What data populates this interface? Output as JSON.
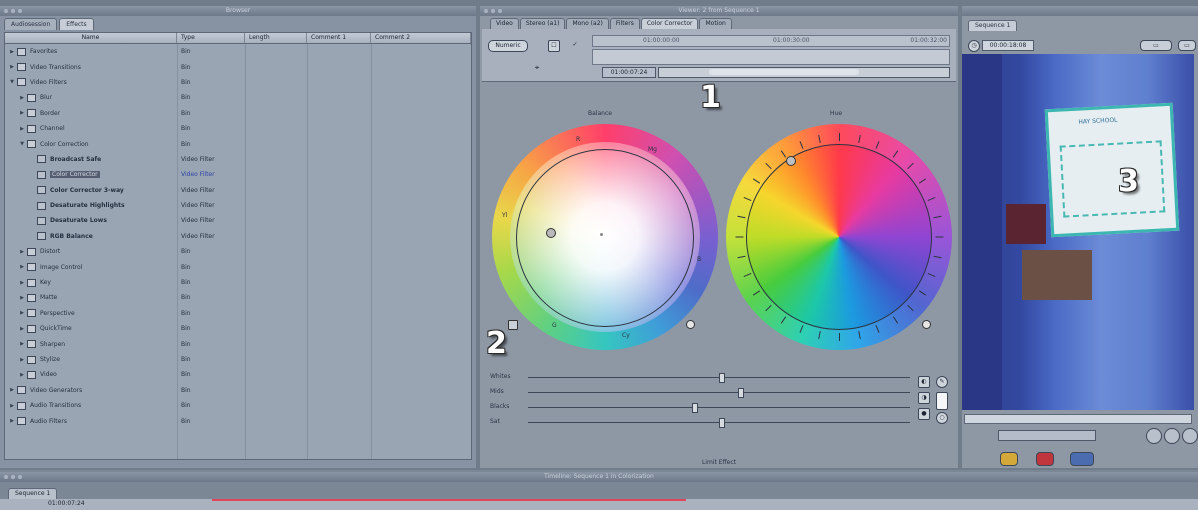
{
  "browser": {
    "title": "Browser",
    "tabs": [
      "Audiosession",
      "Effects"
    ],
    "columns": [
      "Name",
      "Type",
      "Length",
      "Comment 1",
      "Comment 2"
    ],
    "rows": [
      {
        "name": "Favorites",
        "type": "Bin",
        "indent": 0,
        "tri": "▶"
      },
      {
        "name": "Video Transitions",
        "type": "Bin",
        "indent": 0,
        "tri": "▶"
      },
      {
        "name": "Video Filters",
        "type": "Bin",
        "indent": 0,
        "tri": "▼"
      },
      {
        "name": "Blur",
        "type": "Bin",
        "indent": 1,
        "tri": "▶"
      },
      {
        "name": "Border",
        "type": "Bin",
        "indent": 1,
        "tri": "▶"
      },
      {
        "name": "Channel",
        "type": "Bin",
        "indent": 1,
        "tri": "▶"
      },
      {
        "name": "Color Correction",
        "type": "Bin",
        "indent": 1,
        "tri": "▼"
      },
      {
        "name": "Broadcast Safe",
        "type": "Video Filter",
        "indent": 2,
        "tri": "",
        "bold": true
      },
      {
        "name": "Color Corrector",
        "type": "Video Filter",
        "indent": 2,
        "tri": "",
        "selected": true
      },
      {
        "name": "Color Corrector 3-way",
        "type": "Video Filter",
        "indent": 2,
        "tri": "",
        "bold": true
      },
      {
        "name": "Desaturate Highlights",
        "type": "Video Filter",
        "indent": 2,
        "tri": "",
        "bold": true
      },
      {
        "name": "Desaturate Lows",
        "type": "Video Filter",
        "indent": 2,
        "tri": "",
        "bold": true
      },
      {
        "name": "RGB Balance",
        "type": "Video Filter",
        "indent": 2,
        "tri": "",
        "bold": true
      },
      {
        "name": "Distort",
        "type": "Bin",
        "indent": 1,
        "tri": "▶"
      },
      {
        "name": "Image Control",
        "type": "Bin",
        "indent": 1,
        "tri": "▶"
      },
      {
        "name": "Key",
        "type": "Bin",
        "indent": 1,
        "tri": "▶"
      },
      {
        "name": "Matte",
        "type": "Bin",
        "indent": 1,
        "tri": "▶"
      },
      {
        "name": "Perspective",
        "type": "Bin",
        "indent": 1,
        "tri": "▶"
      },
      {
        "name": "QuickTime",
        "type": "Bin",
        "indent": 1,
        "tri": "▶"
      },
      {
        "name": "Sharpen",
        "type": "Bin",
        "indent": 1,
        "tri": "▶"
      },
      {
        "name": "Stylize",
        "type": "Bin",
        "indent": 1,
        "tri": "▶"
      },
      {
        "name": "Video",
        "type": "Bin",
        "indent": 1,
        "tri": "▶"
      },
      {
        "name": "Video Generators",
        "type": "Bin",
        "indent": 0,
        "tri": "▶"
      },
      {
        "name": "Audio Transitions",
        "type": "Bin",
        "indent": 0,
        "tri": "▶"
      },
      {
        "name": "Audio Filters",
        "type": "Bin",
        "indent": 0,
        "tri": "▶"
      }
    ]
  },
  "viewer": {
    "title": "Viewer: 2 from Sequence 1",
    "tabs": [
      "Video",
      "Stereo (a1)",
      "Mono (a2)",
      "Filters",
      "Color Corrector",
      "Motion"
    ],
    "numeric_button": "Numeric",
    "timecodes": [
      "01:00:00:00",
      "01:00:30:00",
      "01:00:32:00"
    ],
    "current_tc": "01:00:07:24",
    "balance_label": "Balance",
    "hue_label": "Hue",
    "wheel_letters": {
      "r": "R",
      "mg": "Mg",
      "b": "B",
      "cy": "Cy",
      "g": "G",
      "yl": "Yl"
    },
    "sliders": [
      {
        "label": "Whites",
        "value": 0.5
      },
      {
        "label": "Mids",
        "value": 0.55
      },
      {
        "label": "Blacks",
        "value": 0.43
      },
      {
        "label": "Sat",
        "value": 0.5
      }
    ],
    "limit_effect": "Limit Effect"
  },
  "canvas": {
    "tab": "Sequence 1",
    "timecode": "00:00:18:08",
    "board_text": "HAY SCHOOL"
  },
  "timeline": {
    "title": "Timeline: Sequence 1 in Colorization",
    "tab": "Sequence 1",
    "tc": "01:00:07:24"
  },
  "callouts": {
    "one": "1",
    "two": "2",
    "three": "3"
  }
}
